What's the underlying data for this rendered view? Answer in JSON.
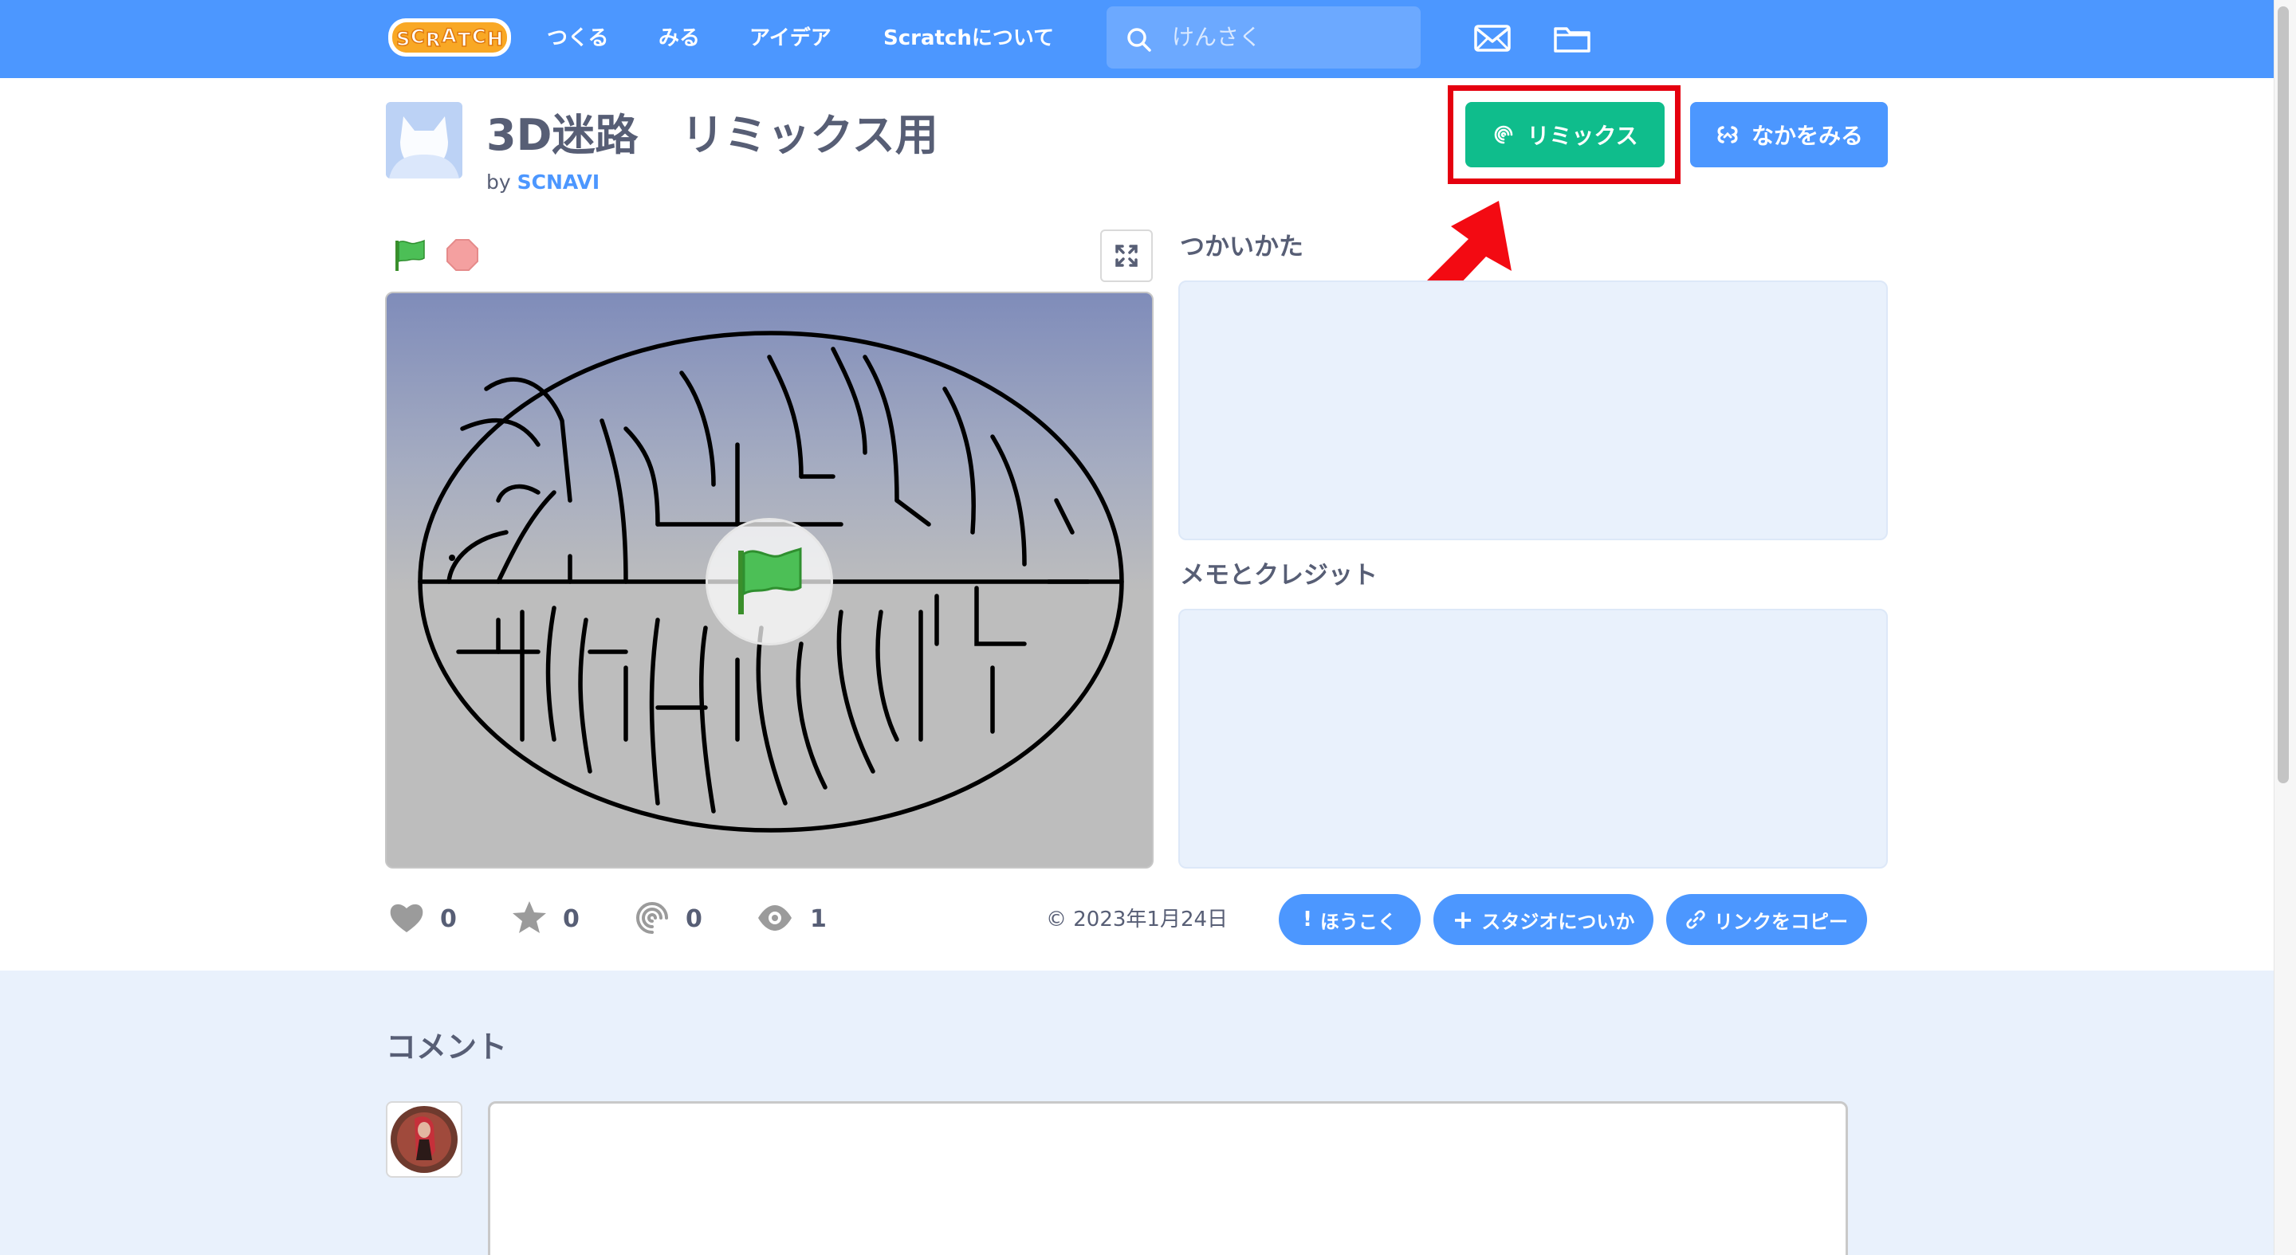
{
  "nav": {
    "logo_alt": "Scratch",
    "items": [
      {
        "label": "つくる"
      },
      {
        "label": "みる"
      },
      {
        "label": "アイデア"
      },
      {
        "label": "Scratchについて"
      }
    ],
    "search_placeholder": "けんさく",
    "icons": [
      "search-icon",
      "mail-icon",
      "folder-icon"
    ],
    "color": "#4c97ff"
  },
  "project": {
    "title": "3D迷路　リミックス用",
    "by_prefix": "by ",
    "author": "SCNAVI",
    "remix_label": "リミックス",
    "see_inside_label": "なかをみる",
    "remix_color": "#0fbd8c",
    "highlight_color": "#e5000f"
  },
  "player": {
    "icons": [
      "green-flag-icon",
      "stop-icon",
      "fullscreen-icon"
    ]
  },
  "instructions": {
    "label": "つかいかた",
    "text": ""
  },
  "notes": {
    "label": "メモとクレジット",
    "text": ""
  },
  "stats": {
    "loves": "0",
    "favorites": "0",
    "remixes": "0",
    "views": "1",
    "date": "2023年1月24日"
  },
  "actions": {
    "report": "ほうこく",
    "add_to_studio": "スタジオについか",
    "copy_link": "リンクをコピー"
  },
  "comments": {
    "title": "コメント",
    "input_value": ""
  }
}
